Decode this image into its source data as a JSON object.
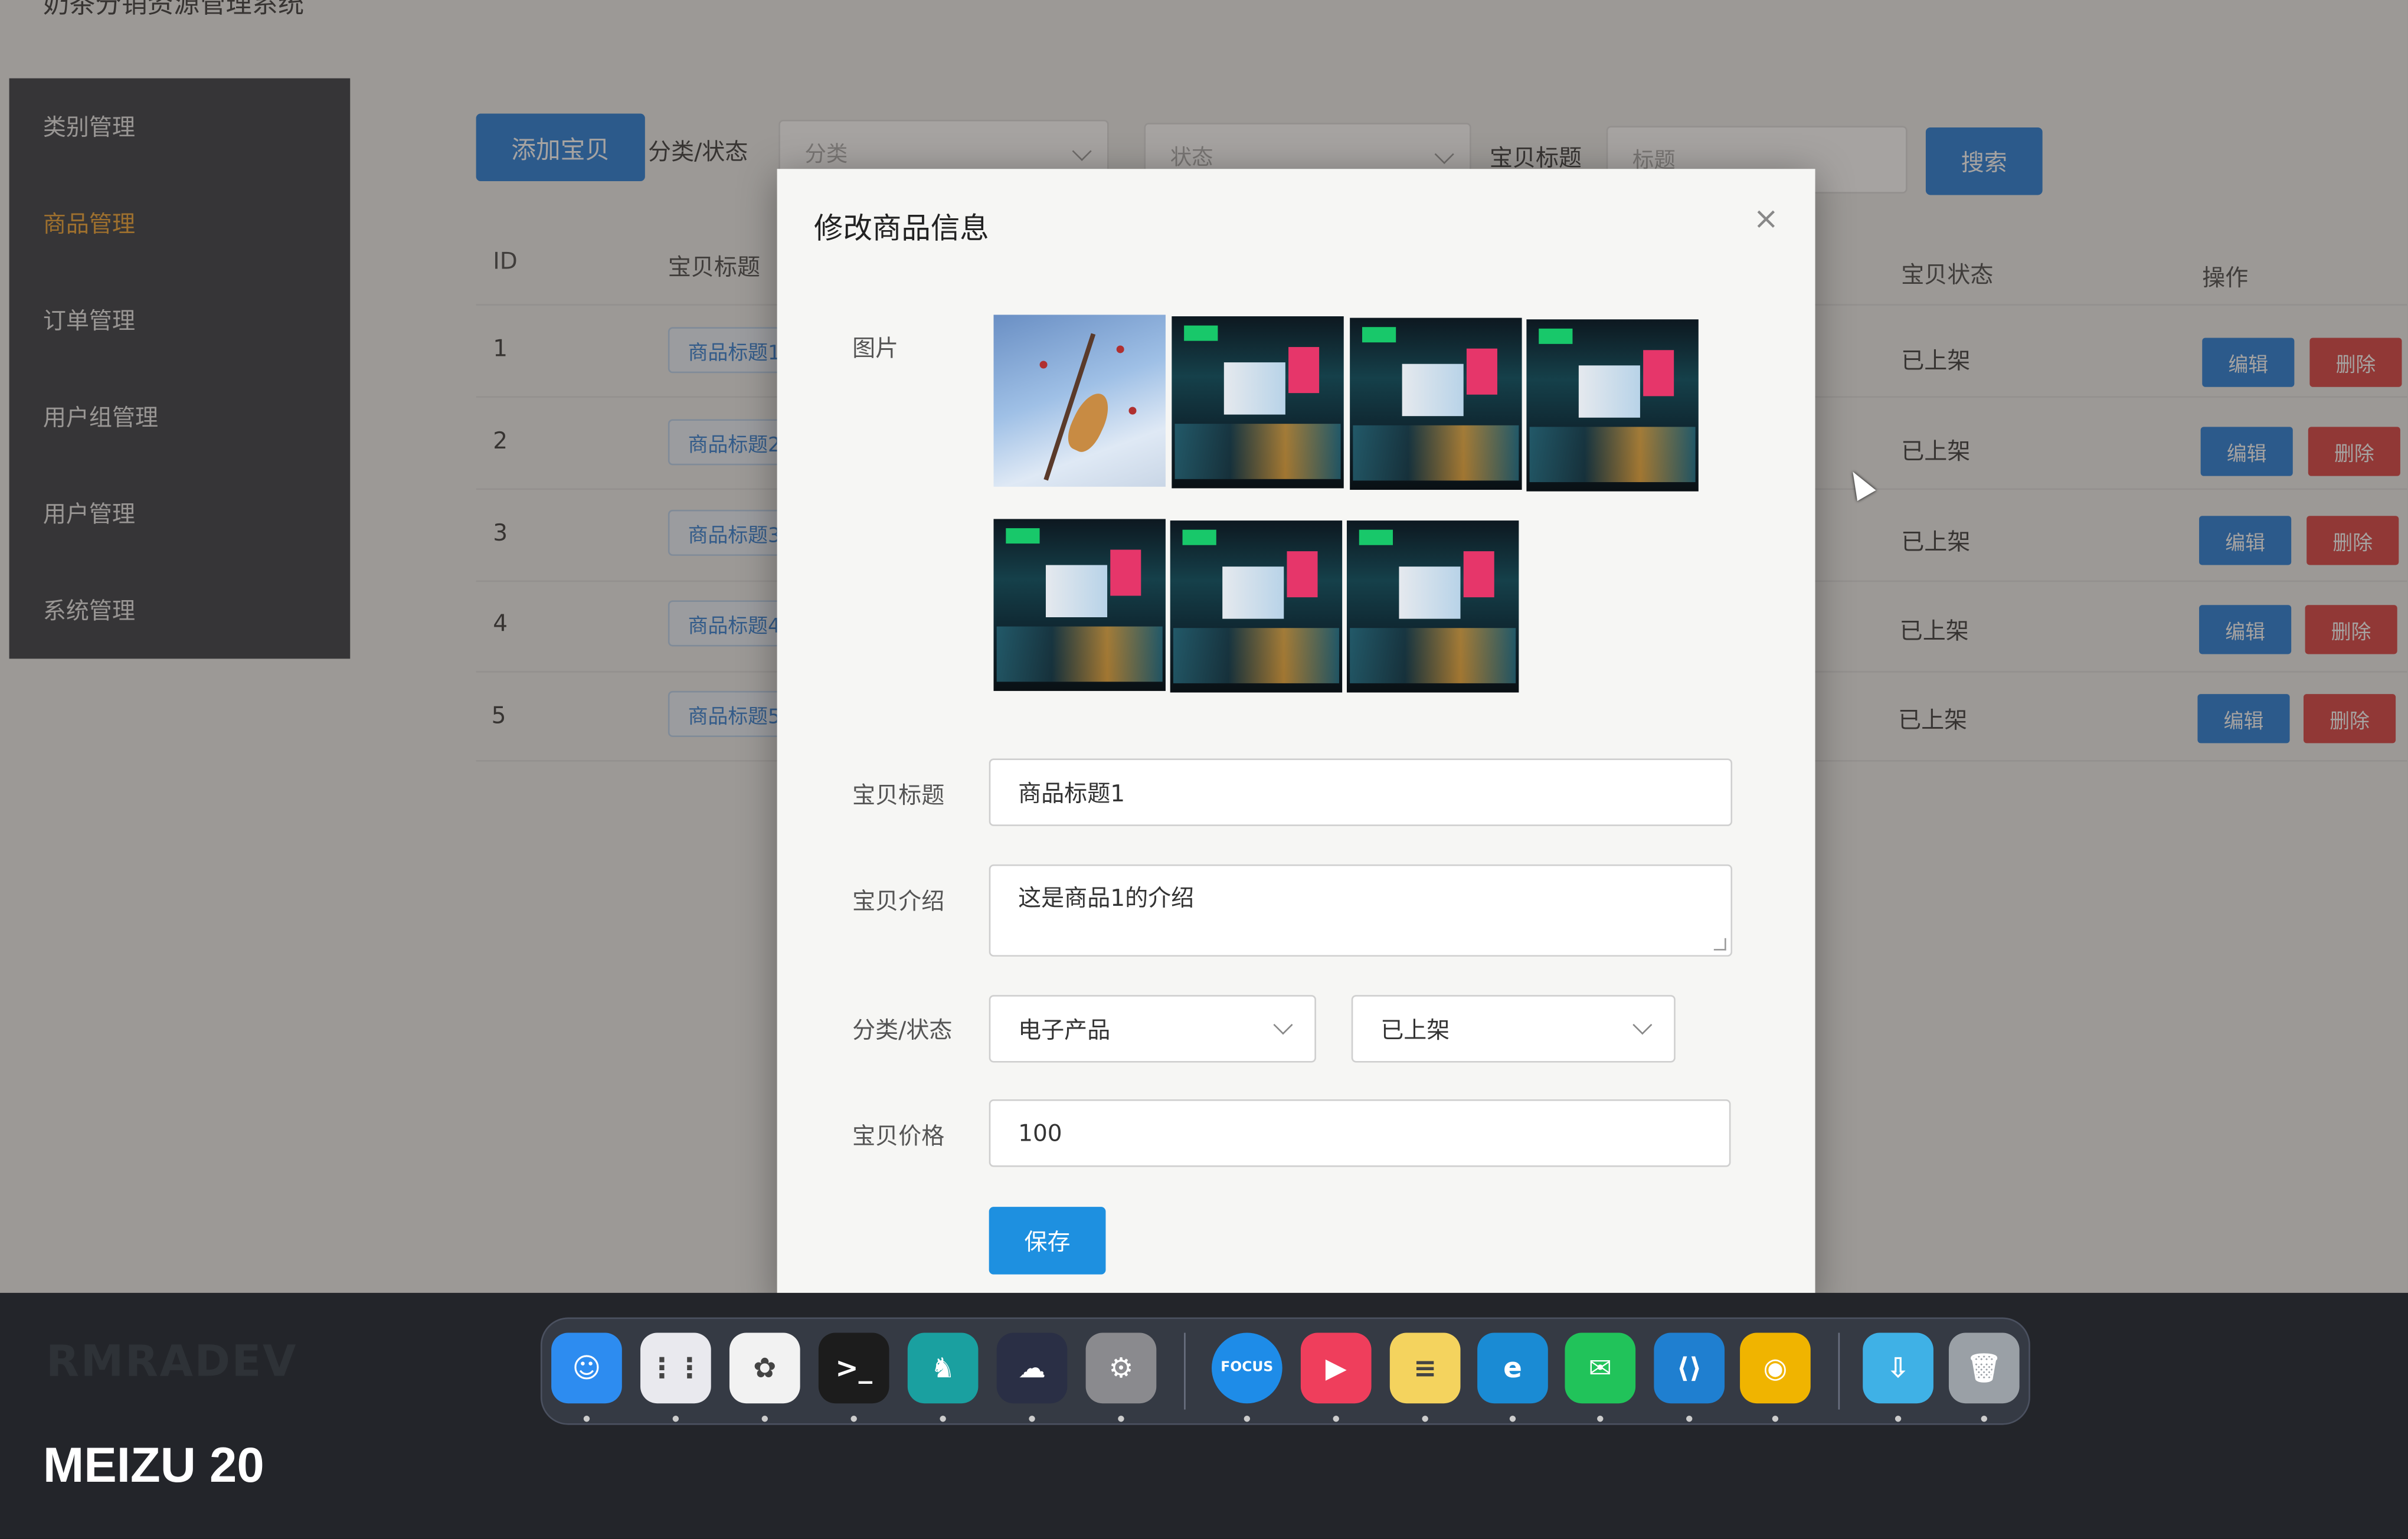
{
  "app": {
    "title": "奶茶分销资源管理系统"
  },
  "sidebar": {
    "items": [
      {
        "label": "类别管理"
      },
      {
        "label": "商品管理",
        "active": true
      },
      {
        "label": "订单管理"
      },
      {
        "label": "用户组管理"
      },
      {
        "label": "用户管理"
      },
      {
        "label": "系统管理"
      }
    ]
  },
  "toolbar": {
    "add_label": "添加宝贝",
    "filter_label": "分类/状态",
    "category_placeholder": "分类",
    "status_placeholder": "状态",
    "title_label": "宝贝标题",
    "title_placeholder": "标题",
    "search_label": "搜索"
  },
  "table": {
    "headers": {
      "id": "ID",
      "title": "宝贝标题",
      "status": "宝贝状态",
      "actions": "操作"
    },
    "rows": [
      {
        "id": "1",
        "title": "商品标题1",
        "status": "已上架"
      },
      {
        "id": "2",
        "title": "商品标题2",
        "status": "已上架"
      },
      {
        "id": "3",
        "title": "商品标题3",
        "status": "已上架"
      },
      {
        "id": "4",
        "title": "商品标题4",
        "status": "已上架"
      },
      {
        "id": "5",
        "title": "商品标题5",
        "status": "已上架"
      }
    ],
    "edit_label": "编辑",
    "delete_label": "删除"
  },
  "modal": {
    "title": "修改商品信息",
    "close_glyph": "×",
    "images_label": "图片",
    "images": [
      "bird",
      "city",
      "city",
      "city",
      "city",
      "city",
      "city"
    ],
    "title_field_label": "宝贝标题",
    "title_value": "商品标题1",
    "desc_label": "宝贝介绍",
    "desc_value": "这是商品1的介绍",
    "category_status_label": "分类/状态",
    "category_value": "电子产品",
    "status_value": "已上架",
    "price_label": "宝贝价格",
    "price_value": "100",
    "save_label": "保存"
  },
  "dock": {
    "apps": [
      {
        "name": "finder-icon",
        "color": "#2d8cf0",
        "glyph": "☺"
      },
      {
        "name": "launchpad-icon",
        "color": "#e9e9ee",
        "glyph": "⋮⋮"
      },
      {
        "name": "chatgpt-icon",
        "color": "#f2f2f2",
        "glyph": "✿"
      },
      {
        "name": "terminal-icon",
        "color": "#1c1c1c",
        "glyph": ">_"
      },
      {
        "name": "sequel-ace-icon",
        "color": "#1aa0a0",
        "glyph": "♞"
      },
      {
        "name": "cloud-icon",
        "color": "#2a2f45",
        "glyph": "☁"
      },
      {
        "name": "system-settings-icon",
        "color": "#8a8a8e",
        "glyph": "⚙"
      },
      {
        "name": "focus-icon",
        "color": "#1e8ce8",
        "glyph": "FOCUS"
      },
      {
        "name": "presentation-icon",
        "color": "#ef3e5c",
        "glyph": "▶"
      },
      {
        "name": "notes-icon",
        "color": "#f4d35e",
        "glyph": "≡"
      },
      {
        "name": "edge-icon",
        "color": "#1a8bd4",
        "glyph": "e"
      },
      {
        "name": "wechat-icon",
        "color": "#21c35a",
        "glyph": "✉"
      },
      {
        "name": "vscode-icon",
        "color": "#1f7fd0",
        "glyph": "⟨⟩"
      },
      {
        "name": "chrome-icon",
        "color": "#f0b400",
        "glyph": "◉"
      },
      {
        "name": "downloads-folder-icon",
        "color": "#3fb1e6",
        "glyph": "⇩"
      },
      {
        "name": "trash-icon",
        "color": "#9aa0a6",
        "glyph": "🗑"
      }
    ]
  },
  "bezel": {
    "brand": "RMRADEV"
  },
  "photo_watermark": "MEIZU 20"
}
